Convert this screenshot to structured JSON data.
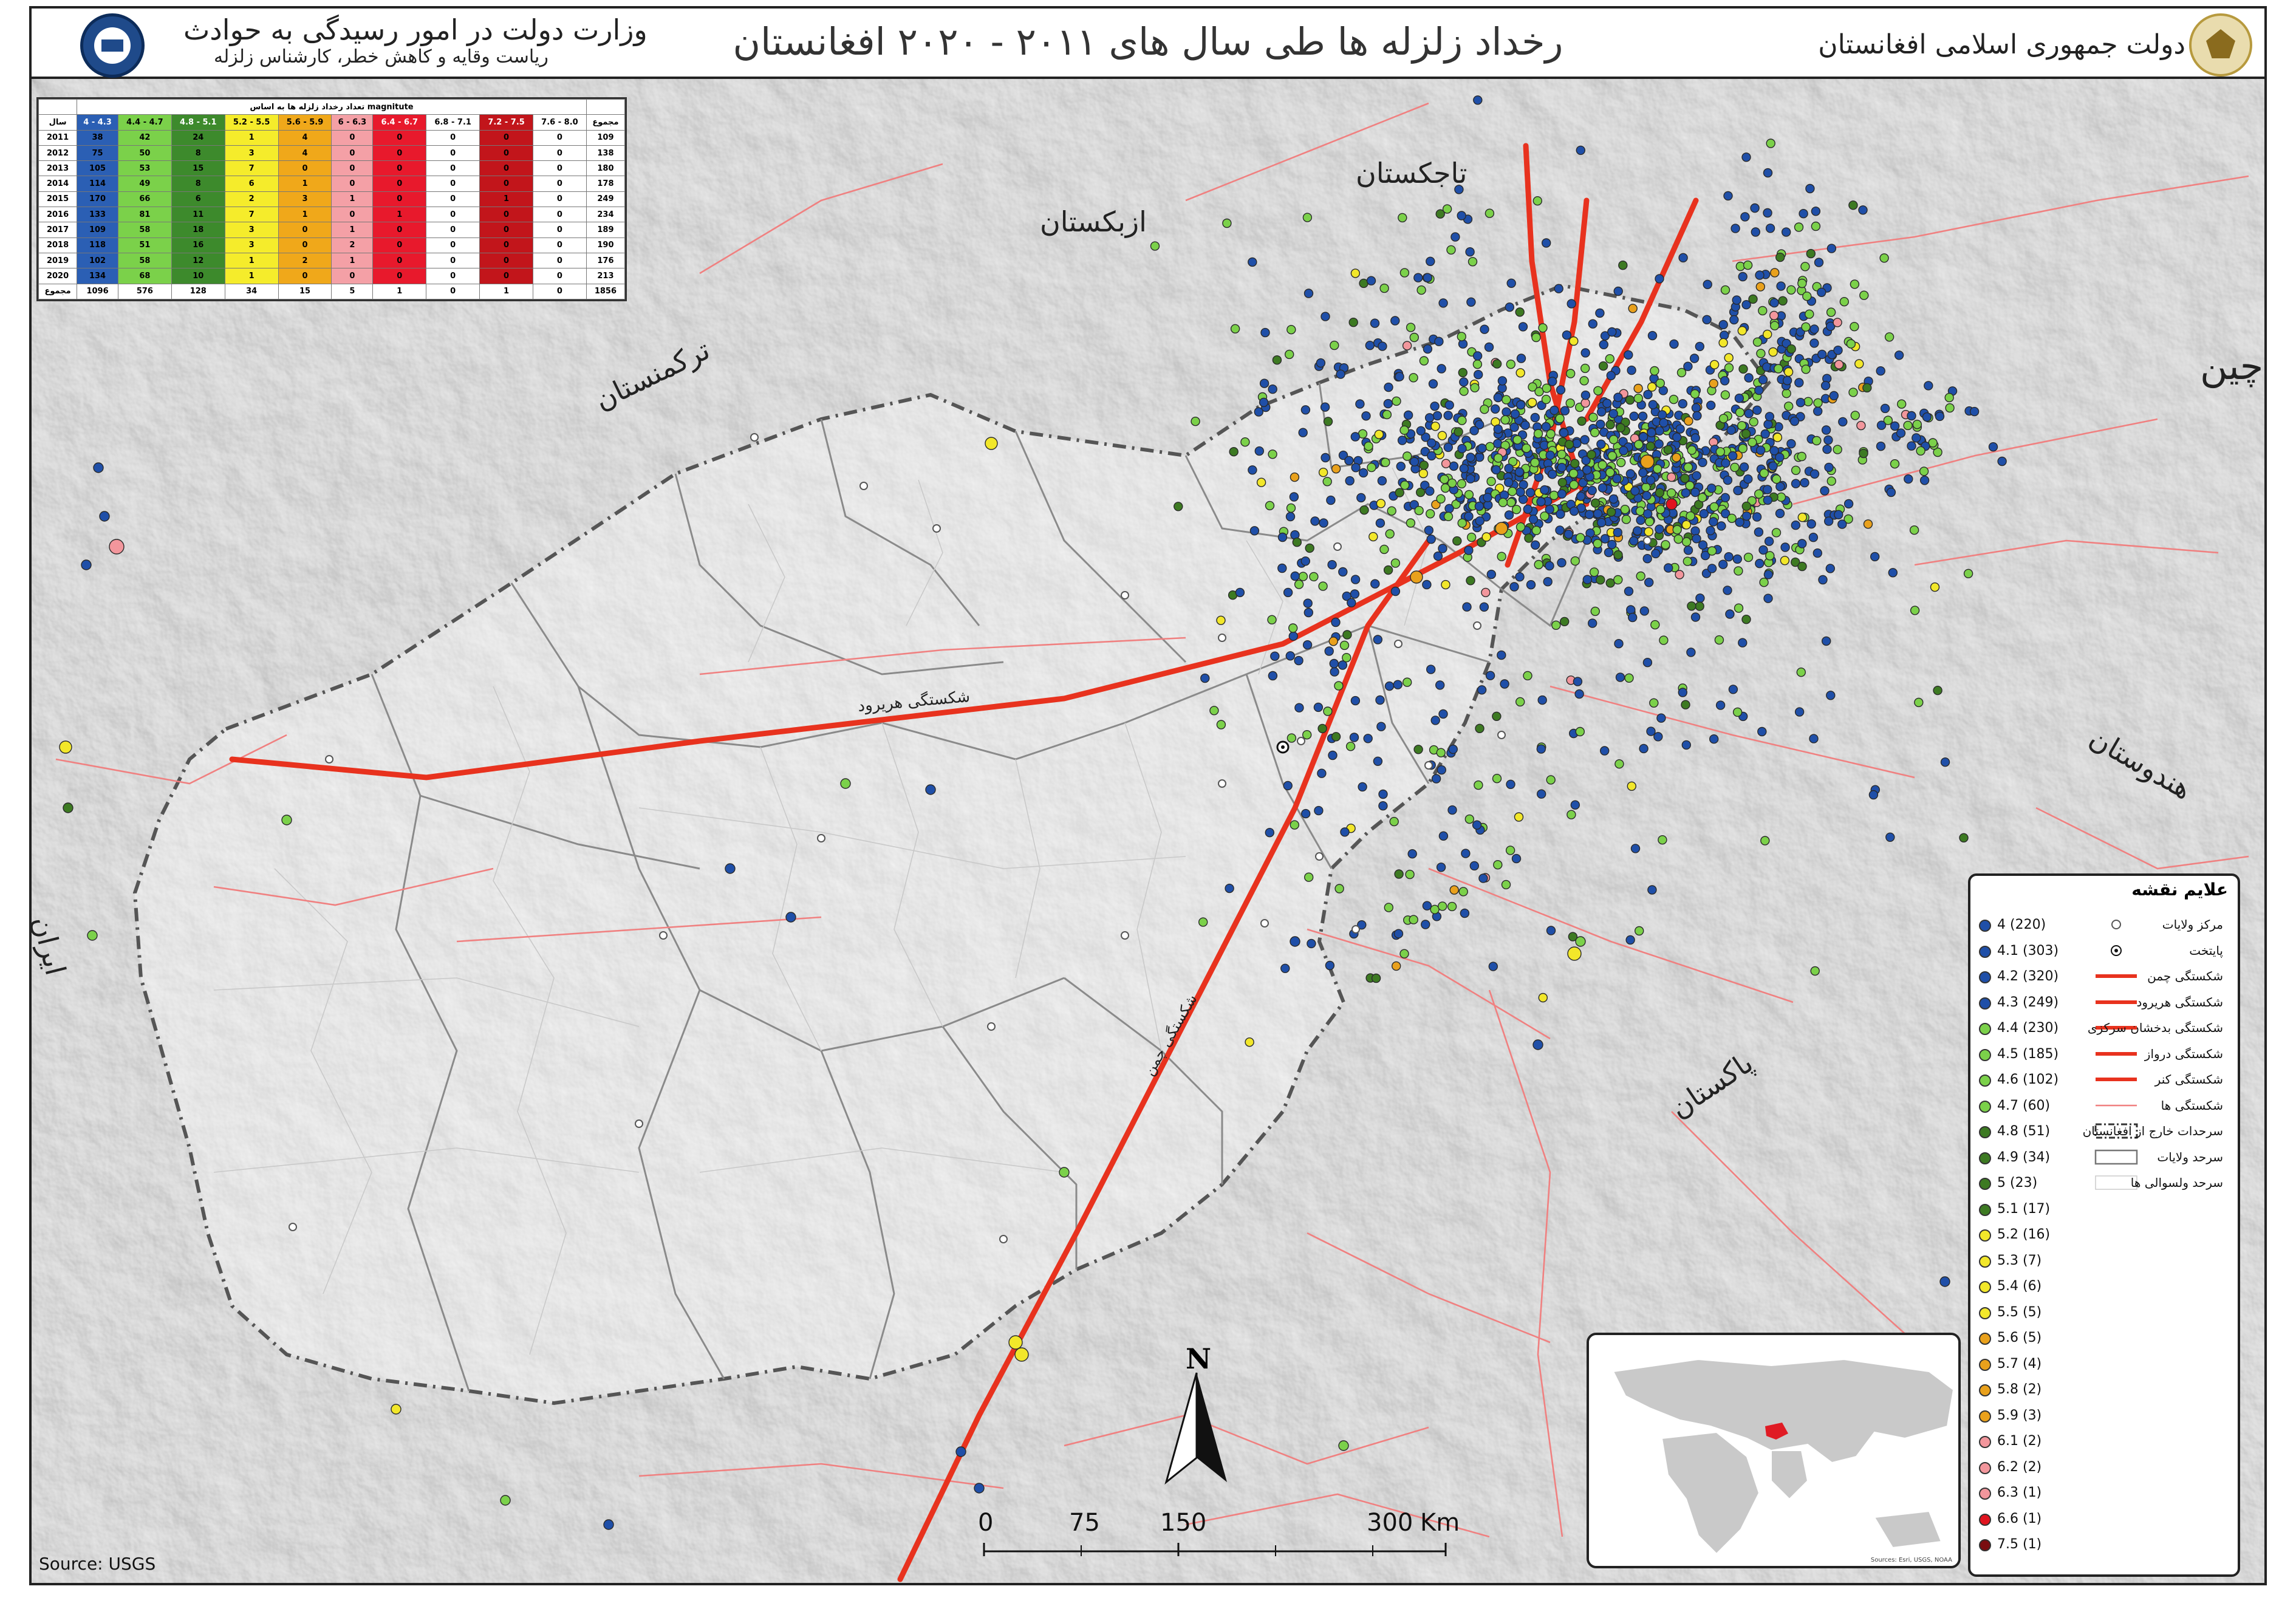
{
  "header": {
    "title": "رخداد زلزله ها طی سال های ۲۰۱۱ - ۲۰۲۰ افغانستان",
    "right_label": "دولت جمهوری اسلامی افغانستان",
    "left_line1": "وزارت دولت در امور رسیدگی به حوادث",
    "left_line2": "ریاست وقایه و کاهش خطر، کارشناس زلزله"
  },
  "stats_table": {
    "caption": "تعداد رخداد زلزله ها به اساس magnitute",
    "year_header": "سال",
    "total_header": "مجموع",
    "totals_label": "مجموع",
    "columns": [
      {
        "label": "4 - 4.3",
        "color": "#2b5fb4"
      },
      {
        "label": "4.4 - 4.7",
        "color": "#7bd14a"
      },
      {
        "label": "4.8 - 5.1",
        "color": "#3d8a2c"
      },
      {
        "label": "5.2 - 5.5",
        "color": "#f5ec2b"
      },
      {
        "label": "5.6 - 5.9",
        "color": "#f0a81a"
      },
      {
        "label": "6 - 6.3",
        "color": "#f4a0a6"
      },
      {
        "label": "6.4 - 6.7",
        "color": "#e8192c"
      },
      {
        "label": "6.8 - 7.1",
        "color": "#ffffff"
      },
      {
        "label": "7.2 - 7.5",
        "color": "#c2151b"
      },
      {
        "label": "7.6 - 8.0",
        "color": "#ffffff"
      }
    ],
    "rows": [
      {
        "year": "2011",
        "values": [
          "38",
          "42",
          "24",
          "1",
          "4",
          "0",
          "0",
          "0",
          "0",
          "0"
        ],
        "total": "109"
      },
      {
        "year": "2012",
        "values": [
          "75",
          "50",
          "8",
          "3",
          "4",
          "0",
          "0",
          "0",
          "0",
          "0"
        ],
        "total": "138"
      },
      {
        "year": "2013",
        "values": [
          "105",
          "53",
          "15",
          "7",
          "0",
          "0",
          "0",
          "0",
          "0",
          "0"
        ],
        "total": "180"
      },
      {
        "year": "2014",
        "values": [
          "114",
          "49",
          "8",
          "6",
          "1",
          "0",
          "0",
          "0",
          "0",
          "0"
        ],
        "total": "178"
      },
      {
        "year": "2015",
        "values": [
          "170",
          "66",
          "6",
          "2",
          "3",
          "1",
          "0",
          "0",
          "1",
          "0"
        ],
        "total": "249"
      },
      {
        "year": "2016",
        "values": [
          "133",
          "81",
          "11",
          "7",
          "1",
          "0",
          "1",
          "0",
          "0",
          "0"
        ],
        "total": "234"
      },
      {
        "year": "2017",
        "values": [
          "109",
          "58",
          "18",
          "3",
          "0",
          "1",
          "0",
          "0",
          "0",
          "0"
        ],
        "total": "189"
      },
      {
        "year": "2018",
        "values": [
          "118",
          "51",
          "16",
          "3",
          "0",
          "2",
          "0",
          "0",
          "0",
          "0"
        ],
        "total": "190"
      },
      {
        "year": "2019",
        "values": [
          "102",
          "58",
          "12",
          "1",
          "2",
          "1",
          "0",
          "0",
          "0",
          "0"
        ],
        "total": "176"
      },
      {
        "year": "2020",
        "values": [
          "134",
          "68",
          "10",
          "1",
          "0",
          "0",
          "0",
          "0",
          "0",
          "0"
        ],
        "total": "213"
      }
    ],
    "totals": [
      "1096",
      "576",
      "128",
      "34",
      "15",
      "5",
      "1",
      "0",
      "1",
      "0"
    ],
    "grand_total": "1856"
  },
  "legend": {
    "title": "علایم نقشه",
    "magnitudes": [
      {
        "label": "4 (220)",
        "color": "#1f4fa8"
      },
      {
        "label": "4.1 (303)",
        "color": "#1f4fa8"
      },
      {
        "label": "4.2 (320)",
        "color": "#1f4fa8"
      },
      {
        "label": "4.3 (249)",
        "color": "#1f4fa8"
      },
      {
        "label": "4.4 (230)",
        "color": "#7bd14a"
      },
      {
        "label": "4.5 (185)",
        "color": "#7bd14a"
      },
      {
        "label": "4.6 (102)",
        "color": "#7bd14a"
      },
      {
        "label": "4.7 (60)",
        "color": "#7bd14a"
      },
      {
        "label": "4.8 (51)",
        "color": "#3d7a22"
      },
      {
        "label": "4.9 (34)",
        "color": "#3d7a22"
      },
      {
        "label": "5 (23)",
        "color": "#3d7a22"
      },
      {
        "label": "5.1 (17)",
        "color": "#3d7a22"
      },
      {
        "label": "5.2 (16)",
        "color": "#f2e72a"
      },
      {
        "label": "5.3 (7)",
        "color": "#f2e72a"
      },
      {
        "label": "5.4 (6)",
        "color": "#f2e72a"
      },
      {
        "label": "5.5 (5)",
        "color": "#f2e72a"
      },
      {
        "label": "5.6 (5)",
        "color": "#e9a11c"
      },
      {
        "label": "5.7 (4)",
        "color": "#e9a11c"
      },
      {
        "label": "5.8 (2)",
        "color": "#e9a11c"
      },
      {
        "label": "5.9 (3)",
        "color": "#e9a11c"
      },
      {
        "label": "6.1 (2)",
        "color": "#f2969c"
      },
      {
        "label": "6.2 (2)",
        "color": "#f2969c"
      },
      {
        "label": "6.3 (1)",
        "color": "#f2969c"
      },
      {
        "label": "6.6 (1)",
        "color": "#e0141f"
      },
      {
        "label": "7.5 (1)",
        "color": "#7a0d10"
      }
    ],
    "symbols": [
      "مرکز ولایات",
      "پایتخت",
      "شکستگی چمن",
      "شکستگی هریرود",
      "شکستگی بدخشان سرکزی",
      "شکستگی درواز",
      "شکستگی کنر",
      "شکستگی ها",
      "سرحدات خارج از افغانستان",
      "سرحد ولایات",
      "سرحد ولسوالی ها"
    ]
  },
  "countries": {
    "tajikistan": "تاجکستان",
    "uzbekistan": "ازبکستان",
    "turkmenistan": "ترکمنستان",
    "china": "چین",
    "india": "هندوستان",
    "pakistan": "پاکستان",
    "iran": "ایران"
  },
  "fault_labels": {
    "harirud": "شکستگی هریرود",
    "chaman": "شکستگی چمن"
  },
  "scale_bar": {
    "ticks": [
      "0",
      "75",
      "150",
      "300"
    ],
    "unit": "Km"
  },
  "north_label": "N",
  "source": "Source: USGS",
  "inset_credit": "Sources: Esri, USGS, NOAA"
}
